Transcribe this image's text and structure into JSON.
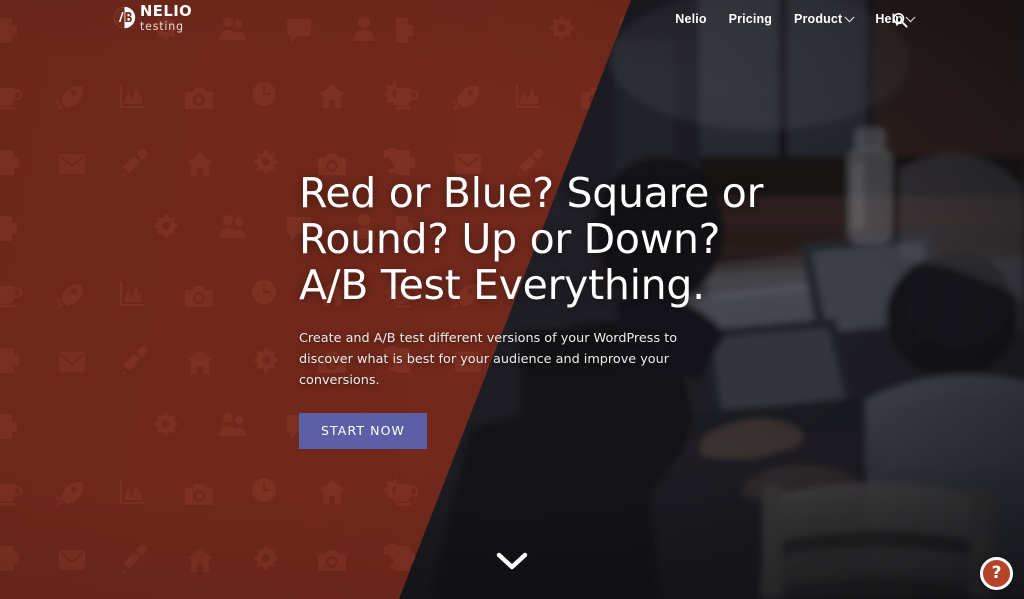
{
  "page": {
    "background_dark": "#16161a",
    "accent_red": "#73291c",
    "cta_color": "#5b5fa6",
    "help_color": "#b5432a"
  },
  "header": {
    "logo": {
      "mark": "ab-circle-logo-icon",
      "name": "NELIO",
      "tagline": "testing"
    },
    "nav": [
      {
        "label": "Nelio",
        "has_dropdown": false
      },
      {
        "label": "Pricing",
        "has_dropdown": false
      },
      {
        "label": "Product",
        "has_dropdown": true
      },
      {
        "label": "Help",
        "has_dropdown": true
      }
    ],
    "search": {
      "icon": "search-icon",
      "label": "Search"
    }
  },
  "hero": {
    "title": "Red or Blue? Square or Round? Up or Down? A/B Test Everything.",
    "subtitle": "Create and A/B test different versions of your WordPress to discover what is best for your audience and improve your conversions.",
    "cta_label": "START NOW",
    "scroll_icon": "chevron-down-icon"
  },
  "widgets": {
    "help_label": "?",
    "help_icon": "question-mark-icon"
  },
  "background_pattern": {
    "icons": [
      "printer-icon",
      "gear-icon",
      "users-icon",
      "speech-bubble-icon",
      "person-icon",
      "camera-icon",
      "trophy-icon",
      "rocket-icon",
      "bar-chart-icon",
      "clock-icon",
      "home-icon",
      "mail-icon",
      "pen-icon",
      "cup-icon"
    ]
  }
}
